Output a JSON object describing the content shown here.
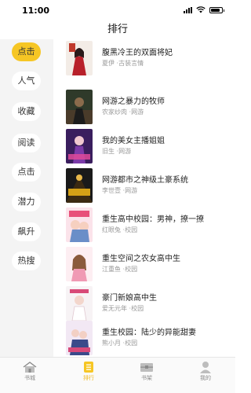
{
  "status": {
    "time": "11:00"
  },
  "nav": {
    "title": "排行"
  },
  "colors": {
    "accent": "#f6c624",
    "sidebar_bg": "#f4f4f4",
    "meta_text": "#9a9a9a"
  },
  "categories": [
    "点击",
    "人气",
    "收藏",
    "阅读",
    "点击",
    "潜力",
    "飙升",
    "热搜"
  ],
  "active_category_index": 0,
  "books": [
    {
      "title": "腹黑冷王的双面将妃",
      "author": "夏伊",
      "genre": "古装言情"
    },
    {
      "title": "网游之暴力的牧师",
      "author": "农家纱肉",
      "genre": "网游"
    },
    {
      "title": "我的美女主播姐姐",
      "author": "旧生",
      "genre": "网游"
    },
    {
      "title": "网游都市之神级土豪系统",
      "author": "李世壹",
      "genre": "网游"
    },
    {
      "title": "重生高中校园：男神，撩一撩",
      "author": "红眼兔",
      "genre": "校园"
    },
    {
      "title": "重生空间之农女高中生",
      "author": "江重鱼",
      "genre": "校园"
    },
    {
      "title": "豪门新娘高中生",
      "author": "爱无元年",
      "genre": "校园"
    },
    {
      "title": "重生校园：陆少的异能甜妻",
      "author": "熊小月",
      "genre": "校园"
    }
  ],
  "book_covers": [
    "ancient-romance-cover",
    "game-priest-cover",
    "streamer-cover",
    "game-tycoon-cover",
    "campus-cover",
    "farm-girl-cover",
    "bride-cover",
    "campus-wife-cover"
  ],
  "tabs": [
    {
      "label": "书城",
      "icon": "bookstore-icon"
    },
    {
      "label": "排行",
      "icon": "ranking-icon"
    },
    {
      "label": "书架",
      "icon": "bookshelf-icon"
    },
    {
      "label": "我的",
      "icon": "profile-icon"
    }
  ],
  "active_tab_index": 1
}
